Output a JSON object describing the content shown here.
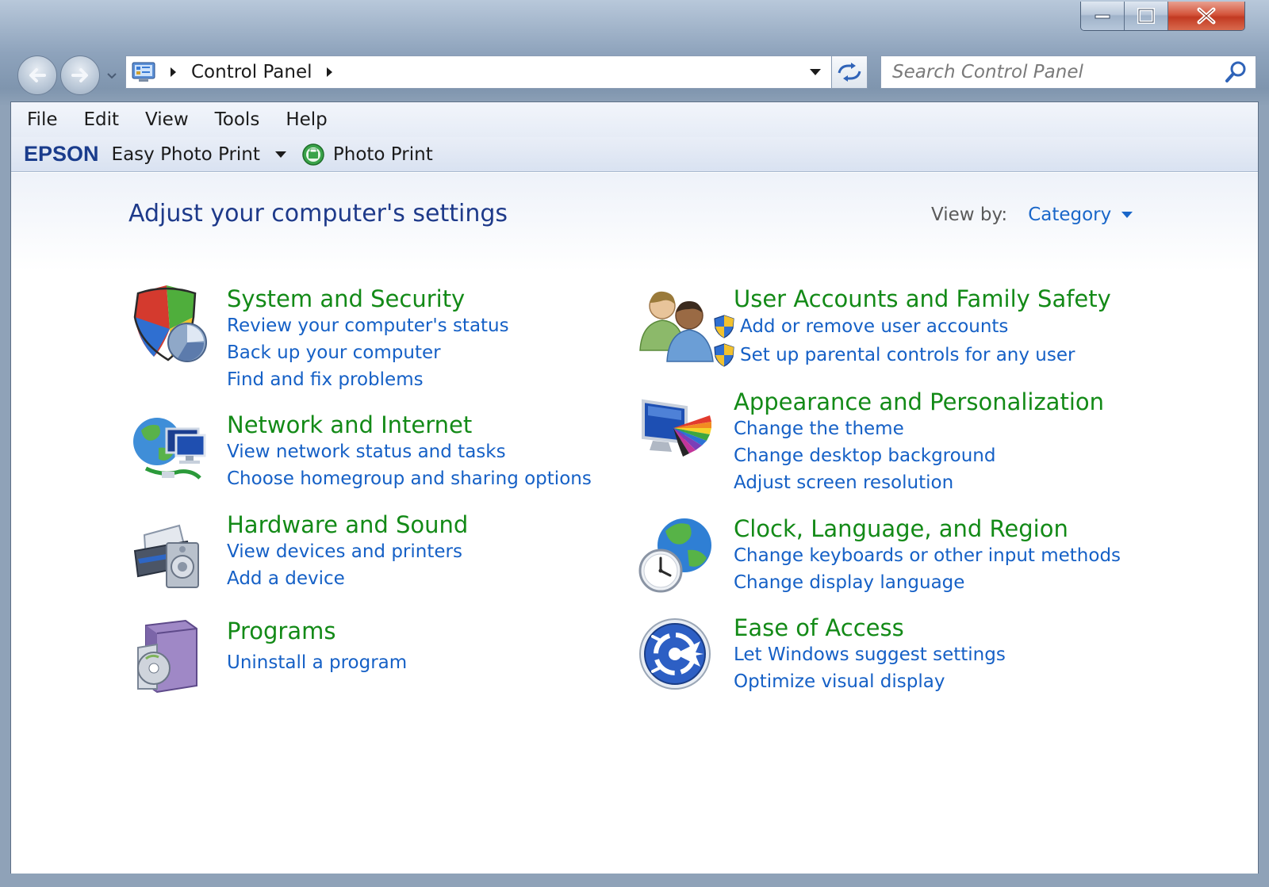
{
  "window": {
    "titlebar_buttons": [
      "minimize",
      "maximize",
      "close"
    ]
  },
  "navigation": {
    "breadcrumb_root": "Control Panel",
    "search_placeholder": "Search Control Panel"
  },
  "menu": {
    "items": [
      "File",
      "Edit",
      "View",
      "Tools",
      "Help"
    ]
  },
  "commandbar": {
    "brand": "EPSON",
    "easy_photo_print": "Easy Photo Print",
    "photo_print": "Photo Print"
  },
  "page": {
    "title": "Adjust your computer's settings",
    "view_by_label": "View by:",
    "view_by_value": "Category"
  },
  "categories": [
    {
      "title": "System and Security",
      "icon": "security-shield-icon",
      "links": [
        "Review your computer's status",
        "Back up your computer",
        "Find and fix problems"
      ]
    },
    {
      "title": "Network and Internet",
      "icon": "network-globe-icon",
      "links": [
        "View network status and tasks",
        "Choose homegroup and sharing options"
      ]
    },
    {
      "title": "Hardware and Sound",
      "icon": "printer-speaker-icon",
      "links": [
        "View devices and printers",
        "Add a device"
      ]
    },
    {
      "title": "Programs",
      "icon": "programs-box-icon",
      "links": [
        "Uninstall a program"
      ]
    },
    {
      "title": "User Accounts and Family Safety",
      "icon": "users-icon",
      "links": [
        "Add or remove user accounts",
        "Set up parental controls for any user"
      ]
    },
    {
      "title": "Appearance and Personalization",
      "icon": "monitor-palette-icon",
      "links": [
        "Change the theme",
        "Change desktop background",
        "Adjust screen resolution"
      ]
    },
    {
      "title": "Clock, Language, and Region",
      "icon": "clock-globe-icon",
      "links": [
        "Change keyboards or other input methods",
        "Change display language"
      ]
    },
    {
      "title": "Ease of Access",
      "icon": "ease-of-access-icon",
      "links": [
        "Let Windows suggest settings",
        "Optimize visual display"
      ]
    }
  ],
  "colors": {
    "category_title": "#138a17",
    "link": "#1560c6",
    "page_title": "#1e3a8a",
    "close_button": "#c23a22"
  }
}
